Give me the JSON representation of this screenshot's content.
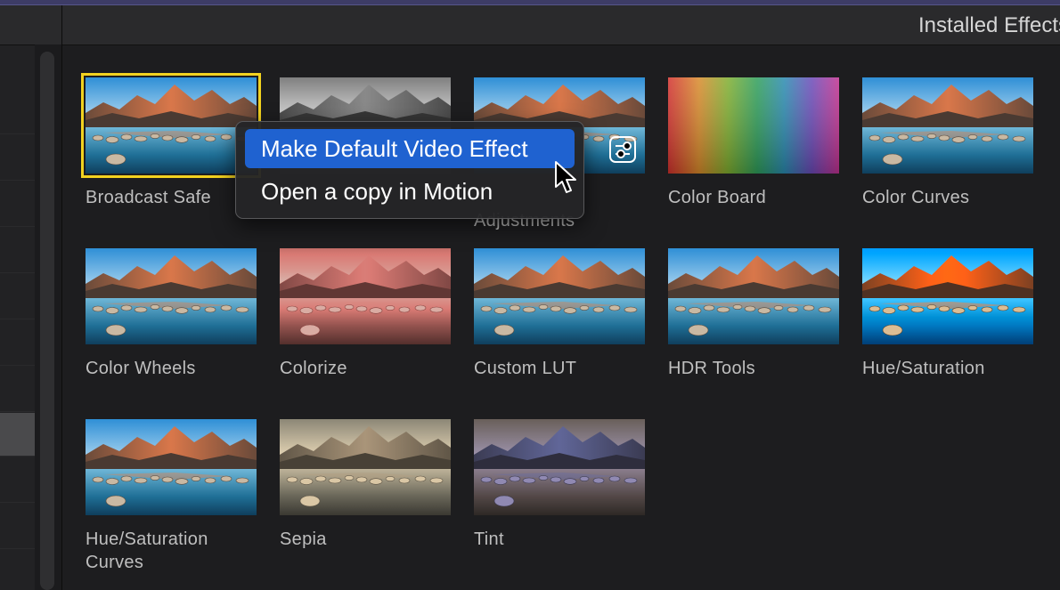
{
  "header": {
    "title": "Installed Effects"
  },
  "effects": [
    {
      "label": "Broadcast Safe",
      "filter": "normal",
      "selected": true
    },
    {
      "label": "",
      "filter": "bw"
    },
    {
      "label": "Adjustments",
      "filter": "normal",
      "settings_icon": "settings-sliders-icon"
    },
    {
      "label": "Color Board",
      "filter": "rainbow"
    },
    {
      "label": "Color Curves",
      "filter": "normal"
    },
    {
      "label": "Color Wheels",
      "filter": "normal"
    },
    {
      "label": "Colorize",
      "filter": "red"
    },
    {
      "label": "Custom LUT",
      "filter": "normal"
    },
    {
      "label": "HDR Tools",
      "filter": "normal"
    },
    {
      "label": "Hue/Saturation",
      "filter": "vivid"
    },
    {
      "label": "Hue/Saturation Curves",
      "filter": "normal"
    },
    {
      "label": "Sepia",
      "filter": "sepia"
    },
    {
      "label": "Tint",
      "filter": "purple"
    }
  ],
  "context_menu": {
    "items": [
      {
        "label": "Make Default Video Effect",
        "highlighted": true
      },
      {
        "label": "Open a copy in Motion",
        "highlighted": false
      }
    ]
  },
  "colors": {
    "selection_border": "#f2d21f",
    "menu_highlight": "#1f62d0",
    "header_accent": "#3d3c66"
  },
  "icons": {
    "cursor": "arrow-cursor-icon"
  }
}
